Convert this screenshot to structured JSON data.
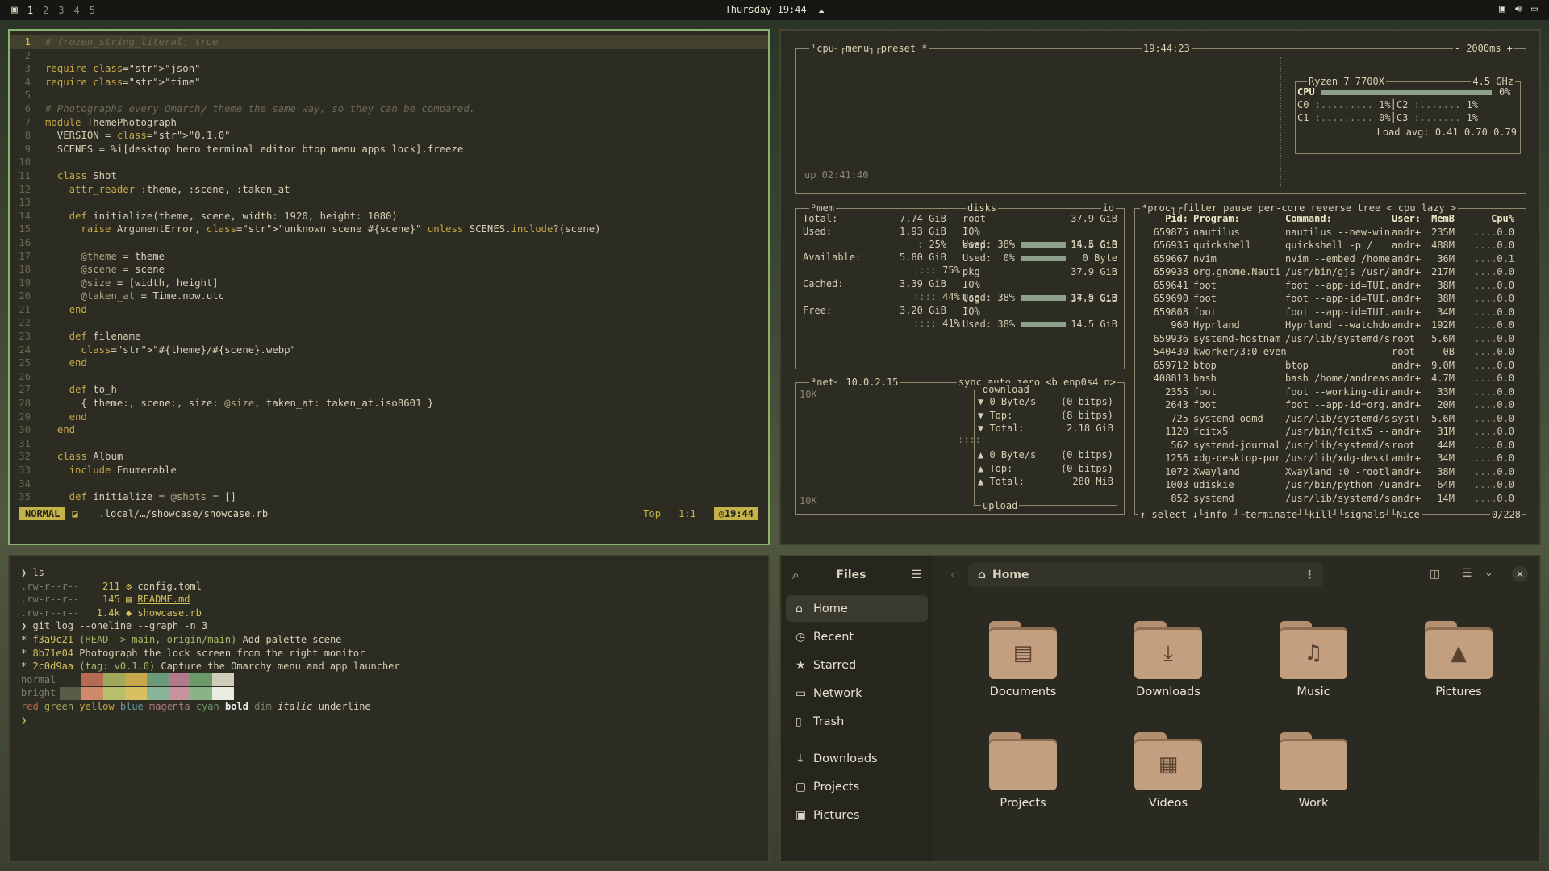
{
  "topbar": {
    "workspaces": [
      "1",
      "2",
      "3",
      "4",
      "5"
    ],
    "active_workspace": "1",
    "clock": "Thursday 19:44"
  },
  "nvim": {
    "lines": [
      "# frozen_string_literal: true",
      "",
      "require \"json\"",
      "require \"time\"",
      "",
      "# Photographs every Omarchy theme the same way, so they can be compared.",
      "module ThemePhotograph",
      "  VERSION = \"0.1.0\"",
      "  SCENES = %i[desktop hero terminal editor btop menu apps lock].freeze",
      "",
      "  class Shot",
      "    attr_reader :theme, :scene, :taken_at",
      "",
      "    def initialize(theme, scene, width: 1920, height: 1080)",
      "      raise ArgumentError, \"unknown scene #{scene}\" unless SCENES.include?(scene)",
      "",
      "      @theme = theme",
      "      @scene = scene",
      "      @size = [width, height]",
      "      @taken_at = Time.now.utc",
      "    end",
      "",
      "    def filename",
      "      \"#{theme}/#{scene}.webp\"",
      "    end",
      "",
      "    def to_h",
      "      { theme:, scene:, size: @size, taken_at: taken_at.iso8601 }",
      "    end",
      "  end",
      "",
      "  class Album",
      "    include Enumerable",
      "",
      "    def initialize = @shots = []"
    ],
    "status": {
      "mode": "NORMAL",
      "path": ".local/…/showcase/showcase.rb",
      "position": "Top",
      "cursor": "1:1",
      "time": "19:44"
    }
  },
  "btop": {
    "cpu": {
      "title": "cpu",
      "menu": "menu",
      "preset": "preset *",
      "time": "19:44:23",
      "interval": "- 2000ms +",
      "uptime": "up 02:41:40",
      "model": "Ryzen 7 7700X",
      "freq": "4.5 GHz",
      "label_cpu": "CPU",
      "cpu_pct": "0%",
      "cores": [
        {
          "n": "C0",
          "v": "1%"
        },
        {
          "n": "C2",
          "v": "1%"
        },
        {
          "n": "C1",
          "v": "0%"
        },
        {
          "n": "C3",
          "v": "1%"
        }
      ],
      "load": "Load avg: 0.41 0.70 0.79"
    },
    "mem": {
      "title": "mem",
      "total": "7.74 GiB",
      "used": "1.93 GiB",
      "used_pct": "25%",
      "avail": "5.80 GiB",
      "avail_pct": "75%",
      "cached": "3.39 GiB",
      "cached_pct": "44%",
      "free": "3.20 GiB",
      "free_pct": "41%"
    },
    "disks": {
      "title": "disks",
      "io": "io",
      "list": [
        {
          "name": "root",
          "size": "37.9 GiB",
          "io": "IO%",
          "used": "Used: 38%",
          "usize": "14.5 GiB"
        },
        {
          "name": "swap",
          "size": "15.4 GiB",
          "io": "",
          "used": "Used:  0%",
          "usize": "0 Byte"
        },
        {
          "name": "pkg",
          "size": "37.9 GiB",
          "io": "IO%",
          "used": "Used: 38%",
          "usize": "14.5 GiB"
        },
        {
          "name": "log",
          "size": "37.9 GiB",
          "io": "IO%",
          "used": "Used: 38%",
          "usize": "14.5 GiB"
        }
      ]
    },
    "net": {
      "title": "net",
      "addr": "10.0.2.15",
      "opts": "sync auto zero <b enp0s4 n>",
      "scale_top": "10K",
      "scale_bot": "10K",
      "dl_label": "download",
      "ul_label": "upload",
      "dl": [
        [
          "▼ 0 Byte/s",
          "(0 bitps)"
        ],
        [
          "▼ Top:",
          "(8 bitps)"
        ],
        [
          "▼ Total:",
          "2.18 GiB"
        ]
      ],
      "ul": [
        [
          "▲ 0 Byte/s",
          "(0 bitps)"
        ],
        [
          "▲ Top:",
          "(0 bitps)"
        ],
        [
          "▲ Total:",
          "280 MiB"
        ]
      ]
    },
    "proc": {
      "title": "proc",
      "opts": "filter  pause per-core reverse tree < cpu lazy >",
      "header": [
        "Pid:",
        "Program:",
        "Command:",
        "User:",
        "MemB",
        "Cpu%"
      ],
      "rows": [
        [
          "659875",
          "nautilus",
          "nautilus --new-win",
          "andr+",
          "235M",
          "0.0"
        ],
        [
          "656935",
          "quickshell",
          "quickshell -p /",
          "andr+",
          "488M",
          "0.0"
        ],
        [
          "659667",
          "nvim",
          "nvim --embed /home",
          "andr+",
          "36M",
          "0.1"
        ],
        [
          "659938",
          "org.gnome.Nauti",
          "/usr/bin/gjs /usr/",
          "andr+",
          "217M",
          "0.0"
        ],
        [
          "659641",
          "foot",
          "foot --app-id=TUI.",
          "andr+",
          "38M",
          "0.0"
        ],
        [
          "659690",
          "foot",
          "foot --app-id=TUI.",
          "andr+",
          "38M",
          "0.0"
        ],
        [
          "659808",
          "foot",
          "foot --app-id=TUI.",
          "andr+",
          "34M",
          "0.0"
        ],
        [
          "960",
          "Hyprland",
          "Hyprland --watchdo",
          "andr+",
          "192M",
          "0.0"
        ],
        [
          "659936",
          "systemd-hostnam",
          "/usr/lib/systemd/s",
          "root",
          "5.6M",
          "0.0"
        ],
        [
          "540430",
          "kworker/3:0-even",
          "",
          "root",
          "0B",
          "0.0"
        ],
        [
          "659712",
          "btop",
          "btop",
          "andr+",
          "9.0M",
          "0.0"
        ],
        [
          "408813",
          "bash",
          "bash /home/andreas",
          "andr+",
          "4.7M",
          "0.0"
        ],
        [
          "2355",
          "foot",
          "foot --working-dir",
          "andr+",
          "33M",
          "0.0"
        ],
        [
          "2643",
          "foot",
          "foot --app-id=org.",
          "andr+",
          "20M",
          "0.0"
        ],
        [
          "725",
          "systemd-oomd",
          "/usr/lib/systemd/s",
          "syst+",
          "5.6M",
          "0.0"
        ],
        [
          "1120",
          "fcitx5",
          "/usr/bin/fcitx5 --",
          "andr+",
          "31M",
          "0.0"
        ],
        [
          "562",
          "systemd-journal",
          "/usr/lib/systemd/s",
          "root",
          "44M",
          "0.0"
        ],
        [
          "1256",
          "xdg-desktop-por",
          "/usr/lib/xdg-deskt",
          "andr+",
          "34M",
          "0.0"
        ],
        [
          "1072",
          "Xwayland",
          "Xwayland :0 -rootl",
          "andr+",
          "38M",
          "0.0"
        ],
        [
          "1003",
          "udiskie",
          "/usr/bin/python /u",
          "andr+",
          "64M",
          "0.0"
        ],
        [
          "852",
          "systemd",
          "/usr/lib/systemd/s",
          "andr+",
          "14M",
          "0.0"
        ]
      ],
      "footer": "↑ select ↓└info ┘└terminate┘└kill┘└signals┘└Nice",
      "count": "0/228"
    }
  },
  "terminal": {
    "prompt1": "❯ ls",
    "ls": [
      [
        ".rw-r--r--",
        "211",
        "config.toml"
      ],
      [
        ".rw-r--r--",
        "145",
        "README.md"
      ],
      [
        ".rw-r--r--",
        "1.4k",
        "showcase.rb"
      ]
    ],
    "prompt2": "❯ git log --oneline --graph -n 3",
    "log": [
      [
        "* ",
        "f3a9c21",
        "(HEAD -> main, origin/main)",
        " Add palette scene"
      ],
      [
        "* ",
        "8b71e04",
        "",
        "Photograph the lock screen from the right monitor"
      ],
      [
        "* ",
        "2c0d9aa",
        "(tag: v0.1.0)",
        " Capture the Omarchy menu and app launcher"
      ]
    ],
    "normal_label": "normal",
    "bright_label": "bright",
    "normal_colors": [
      "#2c2c22",
      "#b66a52",
      "#a0a85a",
      "#c8a64a",
      "#6a9a7a",
      "#b07a8a",
      "#6a9a6a",
      "#d0ccba"
    ],
    "bright_colors": [
      "#5a5a48",
      "#d08a6a",
      "#b6c06a",
      "#d8c060",
      "#88b49a",
      "#c892a0",
      "#88b486",
      "#ecebe2"
    ],
    "styles": [
      "red",
      "green",
      "yellow",
      "blue",
      "magenta",
      "cyan",
      "bold",
      "dim",
      "italic",
      "underline"
    ],
    "prompt3": "❯"
  },
  "files": {
    "app_title": "Files",
    "location": "Home",
    "sidebar": [
      {
        "label": "Home",
        "icon": "home-icon"
      },
      {
        "label": "Recent",
        "icon": "clock-icon"
      },
      {
        "label": "Starred",
        "icon": "star-icon"
      },
      {
        "label": "Network",
        "icon": "network-icon"
      },
      {
        "label": "Trash",
        "icon": "trash-icon"
      }
    ],
    "bookmarks": [
      {
        "label": "Downloads",
        "icon": "download-icon"
      },
      {
        "label": "Projects",
        "icon": "folder-icon"
      },
      {
        "label": "Pictures",
        "icon": "picture-icon"
      }
    ],
    "folders": [
      "Documents",
      "Downloads",
      "Music",
      "Pictures",
      "Projects",
      "Videos",
      "Work"
    ]
  }
}
